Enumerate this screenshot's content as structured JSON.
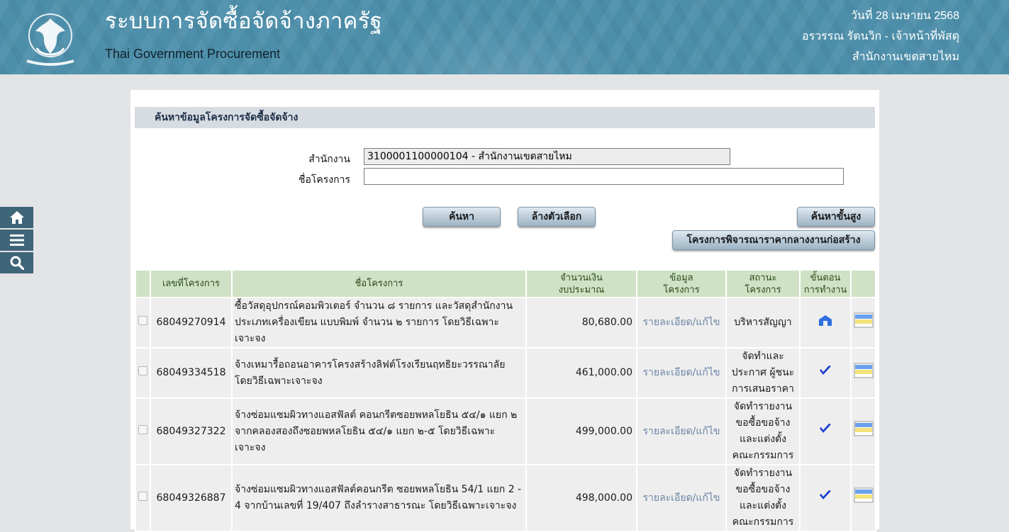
{
  "header": {
    "title": "ระบบการจัดซื้อจัดจ้างภาครัฐ",
    "subtitle": "Thai Government Procurement",
    "date": "วันที่ 28 เมษายน 2568",
    "user": "อรวรรณ รัตนวิก - เจ้าหน้าที่พัสดุ",
    "office": "สำนักงานเขตสายไหม",
    "logo_icon": "garuda-emblem"
  },
  "side_nav": [
    {
      "icon": "home-icon"
    },
    {
      "icon": "menu-icon"
    },
    {
      "icon": "search-icon"
    }
  ],
  "search": {
    "section_title": "ค้นหาข้อมูลโครงการจัดซื้อจัดจ้าง",
    "office_label": "สำนักงาน",
    "office_value": "3100001100000104 - สำนักงานเขตสายไหม",
    "project_label": "ชื่อโครงการ",
    "project_value": "",
    "search_btn": "ค้นหา",
    "clear_btn": "ล้างตัวเลือก",
    "advanced_btn": "ค้นหาขั้นสูง",
    "median_btn": "โครงการพิจารณาราคากลางงานก่อสร้าง"
  },
  "table": {
    "headers": {
      "project_no": "เลขที่โครงการ",
      "project_name": "ชื่อโครงการ",
      "budget_1": "จำนวนเงิน",
      "budget_2": "งบประมาณ",
      "info_1": "ข้อมูล",
      "info_2": "โครงการ",
      "status_1": "สถานะ",
      "status_2": "โครงการ",
      "step_1": "ขั้นตอน",
      "step_2": "การทำงาน"
    },
    "rows": [
      {
        "no": "68049270914",
        "name": "ซื้อวัสดุอุปกรณ์คอมพิวเตอร์ จำนวน ๘ รายการ และวัสดุสำนักงาน ประเภทเครื่องเขียน แบบพิมพ์ จำนวน ๒ รายการ โดยวิธีเฉพาะเจาะจง",
        "amount": "80,680.00",
        "detail": "รายละเอียด/แก้ไข",
        "status": "บริหารสัญญา",
        "step_icon": "contract-icon"
      },
      {
        "no": "68049334518",
        "name": "จ้างเหมารื้อถอนอาคารโครงสร้างลิฟต์โรงเรียนฤทธิยะวรรณาลัย โดยวิธีเฉพาะเจาะจง",
        "amount": "461,000.00",
        "detail": "รายละเอียด/แก้ไข",
        "status": "จัดทำและประกาศ ผู้ชนะการเสนอราคา",
        "step_icon": "check-icon"
      },
      {
        "no": "68049327322",
        "name": "จ้างซ่อมแซมผิวทางแอสฟัลต์ คอนกรีตซอยพหลโยธิน ๕๔/๑ แยก ๒ จากคลองสองถึงซอยพหลโยธิน ๕๔/๑ แยก ๒-๕ โดยวิธีเฉพาะเจาะจง",
        "amount": "499,000.00",
        "detail": "รายละเอียด/แก้ไข",
        "status": "จัดทำรายงานขอซื้อขอจ้างและแต่งตั้งคณะกรรมการ",
        "step_icon": "check-icon"
      },
      {
        "no": "68049326887",
        "name": "จ้างซ่อมแซมผิวทางแอสฟัลต์คอนกรีต ซอยพหลโยธิน 54/1 แยก 2 - 4 จากบ้านเลขที่ 19/407 ถึงลำรางสาธารณะ โดยวิธีเฉพาะเจาะจง",
        "amount": "498,000.00",
        "detail": "รายละเอียด/แก้ไข",
        "status": "จัดทำรายงานขอซื้อขอจ้างและแต่งตั้งคณะกรรมการ",
        "step_icon": "check-icon"
      }
    ]
  },
  "colors": {
    "header_bg": "#4d8fab",
    "table_header_bg": "#cfe2c5",
    "link": "#6b84a5",
    "check": "#1f3fd0"
  }
}
